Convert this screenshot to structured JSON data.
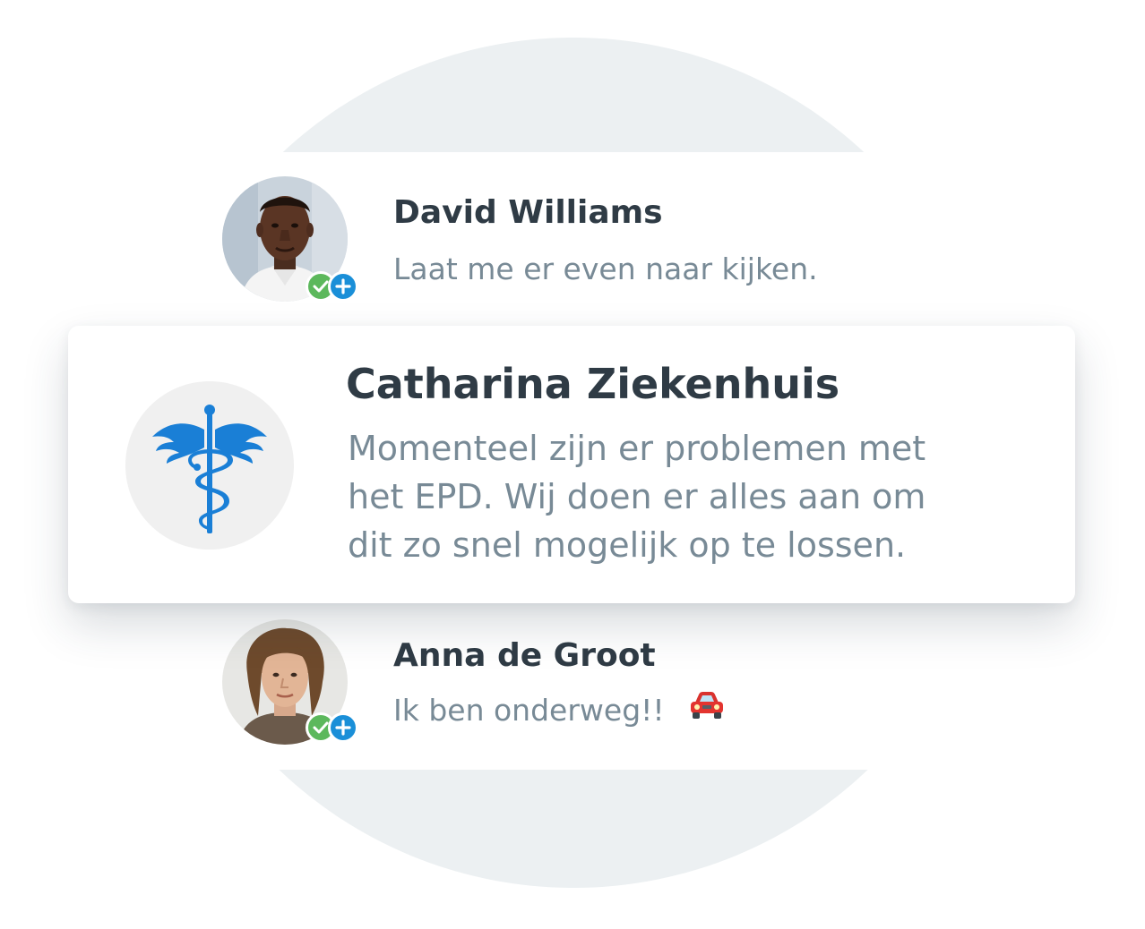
{
  "conversations": [
    {
      "name": "David Williams",
      "message": "Laat me er even naar kijken.",
      "avatar": "man-portrait-avatar",
      "badges": [
        "check-icon",
        "plus-icon"
      ]
    },
    {
      "name": "Catharina Ziekenhuis",
      "message_lines": [
        "Momenteel zijn er problemen met",
        "het EPD. Wij doen er alles aan om",
        "dit zo snel mogelijk op te lossen."
      ],
      "avatar": "caduceus-icon",
      "highlighted": true
    },
    {
      "name": "Anna de Groot",
      "message": "Ik ben onderweg!!",
      "emoji": "car-icon",
      "avatar": "young-person-portrait-avatar",
      "badges": [
        "check-icon",
        "plus-icon"
      ]
    }
  ],
  "colors": {
    "background_circle": "#ecf0f2",
    "name_text": "#2f3b45",
    "message_text": "#788a96",
    "check_badge": "#5cb85c",
    "plus_badge": "#1a8fd8",
    "caduceus": "#1a7fd6",
    "car": "#e3342f"
  }
}
